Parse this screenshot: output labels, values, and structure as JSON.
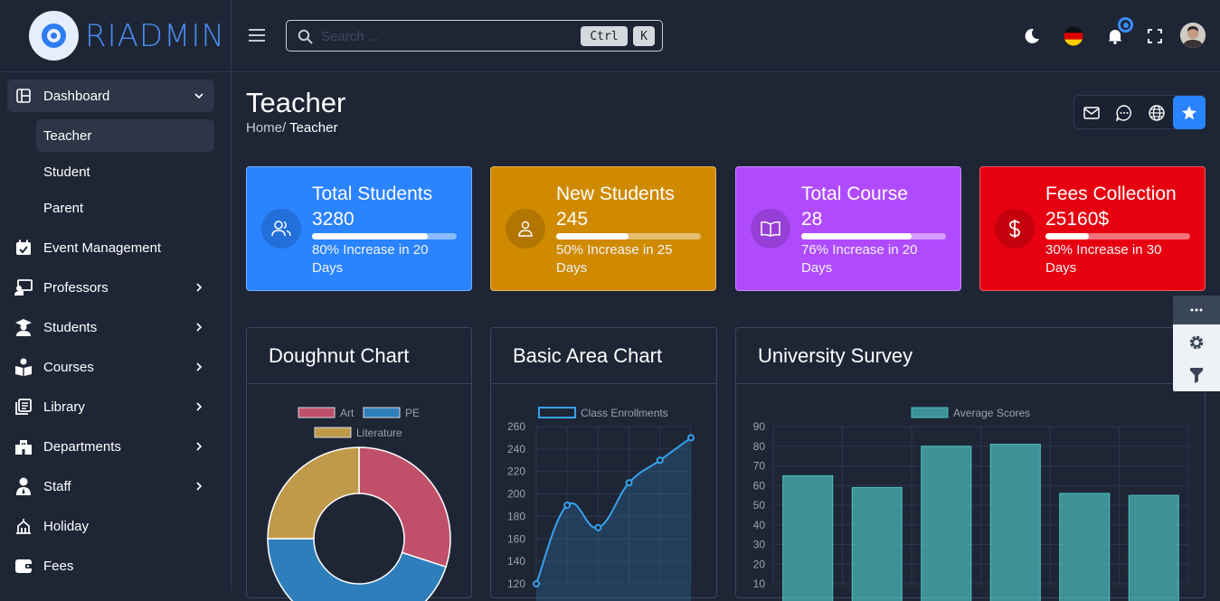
{
  "brand": {
    "logo_text": "RIADMIN"
  },
  "sidebar": {
    "dashboard": {
      "label": "Dashboard"
    },
    "sub_items": [
      {
        "label": "Teacher"
      },
      {
        "label": "Student"
      },
      {
        "label": "Parent"
      }
    ],
    "items": [
      {
        "label": "Event Management",
        "icon": "calendar-check-icon"
      },
      {
        "label": "Professors",
        "icon": "chalkboard-teacher-icon"
      },
      {
        "label": "Students",
        "icon": "graduation-cap-icon"
      },
      {
        "label": "Courses",
        "icon": "book-reader-icon"
      },
      {
        "label": "Library",
        "icon": "library-icon"
      },
      {
        "label": "Departments",
        "icon": "building-icon"
      },
      {
        "label": "Staff",
        "icon": "staff-icon"
      },
      {
        "label": "Holiday",
        "icon": "holiday-icon"
      },
      {
        "label": "Fees",
        "icon": "wallet-icon"
      }
    ]
  },
  "topbar": {
    "search_placeholder": "Search ...",
    "kbd_ctrl": "Ctrl",
    "kbd_k": "K"
  },
  "page": {
    "title": "Teacher",
    "breadcrumb_home": "Home/",
    "breadcrumb_current": "Teacher"
  },
  "stats": [
    {
      "title": "Total Students",
      "value": "3280",
      "progress": 0.8,
      "desc": "80% Increase in 20 Days",
      "color": "#2a83ff",
      "icon": "users-icon"
    },
    {
      "title": "New Students",
      "value": "245",
      "progress": 0.5,
      "desc": "50% Increase in 25 Days",
      "color": "#d08a00",
      "icon": "user-icon"
    },
    {
      "title": "Total Course",
      "value": "28",
      "progress": 0.76,
      "desc": "76% Increase in 20 Days",
      "color": "#b04bfd",
      "icon": "book-icon"
    },
    {
      "title": "Fees Collection",
      "value": "25160$",
      "progress": 0.3,
      "desc": "30% Increase in 30 Days",
      "color": "#e7000f",
      "icon": "dollar-icon"
    }
  ],
  "panels": {
    "doughnut": "Doughnut Chart",
    "area": "Basic Area Chart",
    "survey": "University Survey"
  },
  "chart_data": [
    {
      "type": "pie",
      "title": "Doughnut Chart",
      "categories": [
        "Art",
        "PE",
        "Literature"
      ],
      "values": [
        30,
        45,
        25
      ],
      "colors": [
        "#c0506a",
        "#2f7ebc",
        "#be9a4a"
      ]
    },
    {
      "type": "area",
      "title": "Basic Area Chart",
      "series": [
        {
          "name": "Class Enrollments",
          "values": [
            120,
            190,
            170,
            210,
            230,
            250
          ]
        }
      ],
      "ylim": [
        120,
        260
      ],
      "yticks": [
        120,
        140,
        160,
        180,
        200,
        220,
        240,
        260
      ]
    },
    {
      "type": "bar",
      "title": "University Survey",
      "series": [
        {
          "name": "Average Scores",
          "values": [
            65,
            59,
            80,
            81,
            56,
            55
          ]
        }
      ],
      "ylim": [
        10,
        90
      ],
      "yticks": [
        10,
        20,
        30,
        40,
        50,
        60,
        70,
        80,
        90
      ]
    }
  ]
}
